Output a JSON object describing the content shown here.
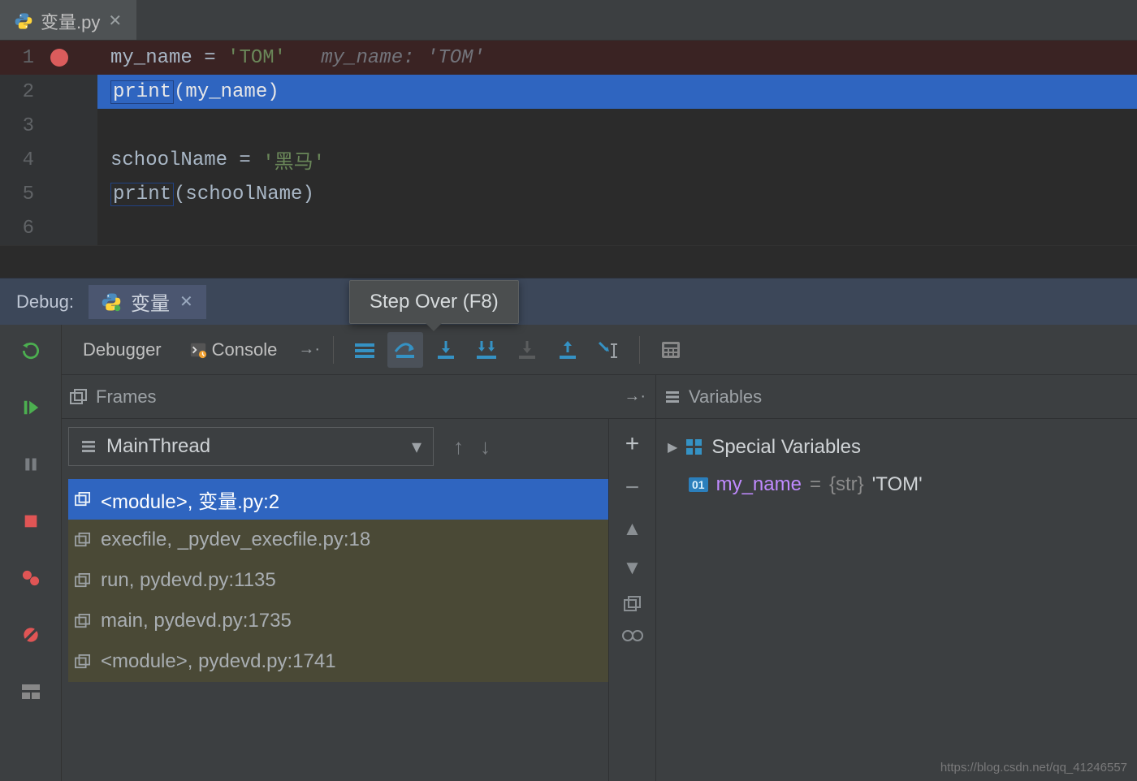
{
  "tab": {
    "filename": "变量.py"
  },
  "code": {
    "lines": [
      {
        "n": 1,
        "bp": true,
        "hl": "bp",
        "tokens": [
          {
            "c": "t-var",
            "t": "my_name"
          },
          {
            "c": "t-op",
            "t": " = "
          },
          {
            "c": "t-str",
            "t": "'TOM'"
          },
          {
            "c": "t-var",
            "t": "   "
          },
          {
            "c": "t-hint",
            "t": "my_name: 'TOM'"
          }
        ]
      },
      {
        "n": 2,
        "bp": false,
        "hl": "cur",
        "tokens": [
          {
            "c": "t-fnCur print-box",
            "t": "print"
          },
          {
            "c": "t-var",
            "t": "(my_name)"
          }
        ]
      },
      {
        "n": 3,
        "bp": false,
        "hl": "",
        "tokens": []
      },
      {
        "n": 4,
        "bp": false,
        "hl": "",
        "tokens": [
          {
            "c": "t-var",
            "t": "schoolName"
          },
          {
            "c": "t-op",
            "t": " = "
          },
          {
            "c": "t-str",
            "t": "'黑马'"
          }
        ]
      },
      {
        "n": 5,
        "bp": false,
        "hl": "",
        "tokens": [
          {
            "c": "t-fn print-box",
            "t": "print"
          },
          {
            "c": "t-var",
            "t": "(schoolName)"
          }
        ]
      },
      {
        "n": 6,
        "bp": false,
        "hl": "",
        "tokens": []
      }
    ]
  },
  "tooltip": {
    "text": "Step Over (F8)"
  },
  "debug": {
    "label": "Debug:",
    "config": "变量",
    "tabs": {
      "debugger": "Debugger",
      "console": "Console"
    },
    "framesTitle": "Frames",
    "varsTitle": "Variables",
    "thread": "MainThread",
    "frames": [
      {
        "label": "<module>, 变量.py:2",
        "sel": true
      },
      {
        "label": "execfile, _pydev_execfile.py:18"
      },
      {
        "label": "run, pydevd.py:1135"
      },
      {
        "label": "main, pydevd.py:1735"
      },
      {
        "label": "<module>, pydevd.py:1741"
      }
    ],
    "vars": {
      "special": "Special Variables",
      "item": {
        "name": "my_name",
        "eq": " = ",
        "type": "{str} ",
        "val": "'TOM'"
      }
    }
  },
  "watermark": "https://blog.csdn.net/qq_41246557"
}
